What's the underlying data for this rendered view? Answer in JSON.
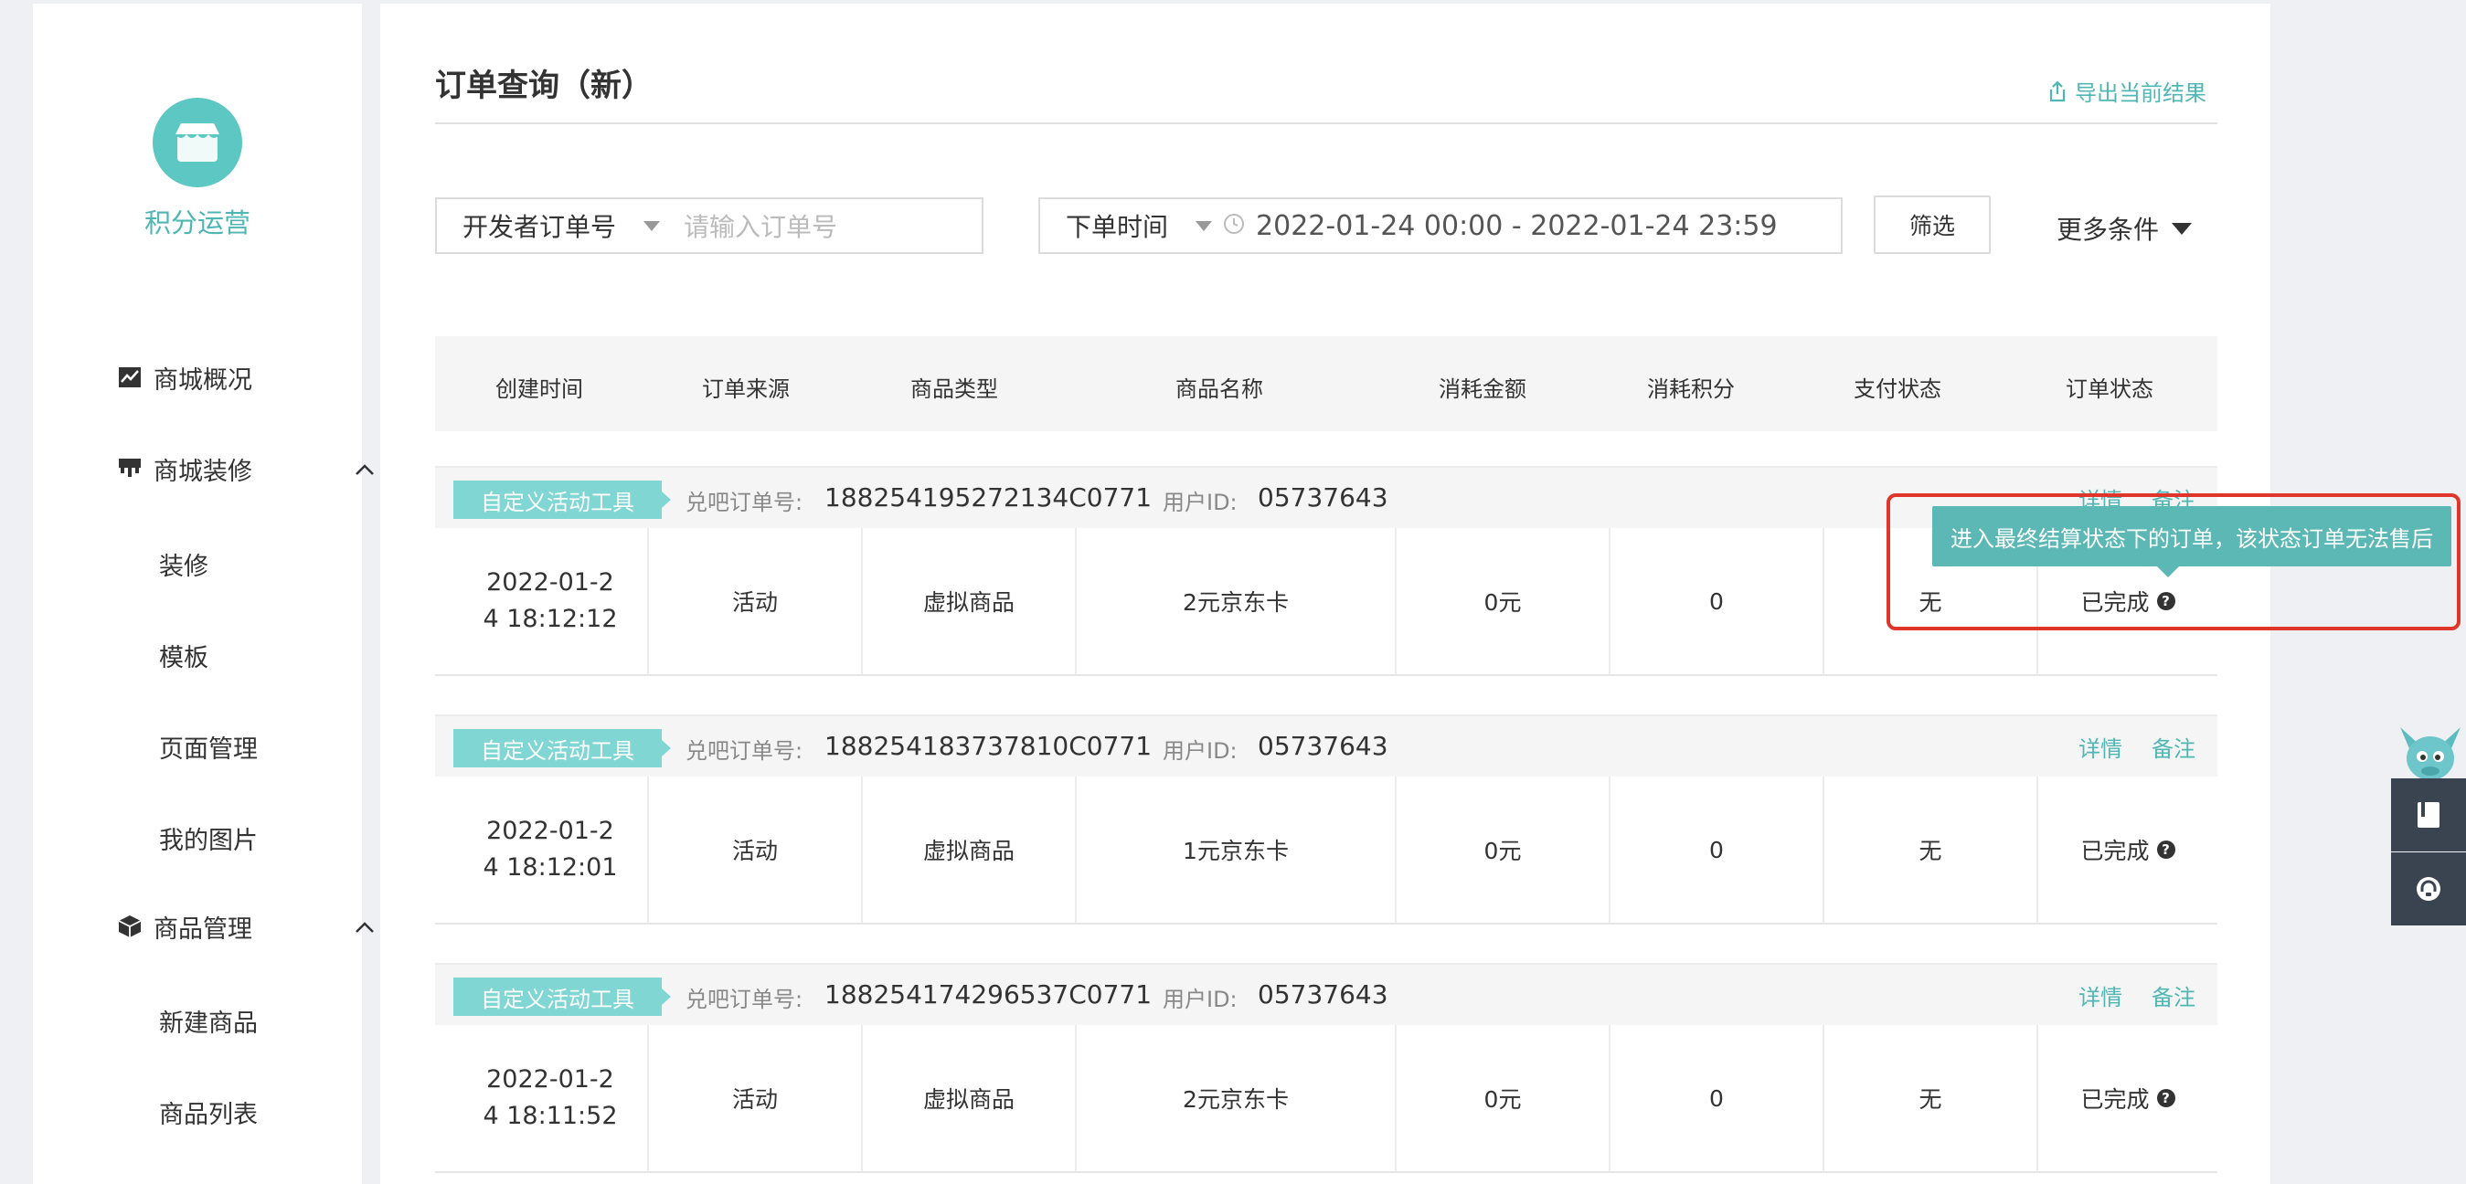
{
  "sidebar": {
    "app_name": "积分运营",
    "nav": [
      {
        "label": "商城概况",
        "icon": "chart-icon"
      },
      {
        "label": "商城装修",
        "icon": "brush-icon",
        "expanded": true,
        "children": [
          "装修",
          "模板",
          "页面管理",
          "我的图片"
        ]
      },
      {
        "label": "商品管理",
        "icon": "box-icon",
        "expanded": true,
        "children": [
          "新建商品",
          "商品列表"
        ]
      }
    ]
  },
  "header": {
    "title": "订单查询（新）",
    "export_label": "导出当前结果"
  },
  "filters": {
    "order_type_selected": "开发者订单号",
    "order_placeholder": "请输入订单号",
    "time_type_selected": "下单时间",
    "time_range": "2022-01-24 00:00 - 2022-01-24 23:59",
    "filter_button": "筛选",
    "more_conditions": "更多条件"
  },
  "table": {
    "columns": [
      "创建时间",
      "订单来源",
      "商品类型",
      "商品名称",
      "消耗金额",
      "消耗积分",
      "支付状态",
      "订单状态"
    ],
    "order_no_label": "兑吧订单号:",
    "user_id_label": "用户ID:",
    "detail_link": "详情",
    "note_link": "备注",
    "orders": [
      {
        "tag": "自定义活动工具",
        "order_no": "188254195272134C0771",
        "user_id": "05737643",
        "date_line1": "2022-01-2",
        "date_line2": "4 18:12:12",
        "source": "活动",
        "goods_type": "虚拟商品",
        "goods_name": "2元京东卡",
        "amount": "0元",
        "points": "0",
        "pay_status": "无",
        "order_status": "已完成"
      },
      {
        "tag": "自定义活动工具",
        "order_no": "188254183737810C0771",
        "user_id": "05737643",
        "date_line1": "2022-01-2",
        "date_line2": "4 18:12:01",
        "source": "活动",
        "goods_type": "虚拟商品",
        "goods_name": "1元京东卡",
        "amount": "0元",
        "points": "0",
        "pay_status": "无",
        "order_status": "已完成"
      },
      {
        "tag": "自定义活动工具",
        "order_no": "188254174296537C0771",
        "user_id": "05737643",
        "date_line1": "2022-01-2",
        "date_line2": "4 18:11:52",
        "source": "活动",
        "goods_type": "虚拟商品",
        "goods_name": "2元京东卡",
        "amount": "0元",
        "points": "0",
        "pay_status": "无",
        "order_status": "已完成"
      }
    ]
  },
  "tooltip": {
    "text": "进入最终结算状态下的订单，该状态订单无法售后"
  },
  "colors": {
    "accent": "#4fb7b3",
    "tag_bg": "#7fd6d2",
    "tooltip_bg": "#5cb8b4",
    "highlight_border": "#e0352b"
  }
}
